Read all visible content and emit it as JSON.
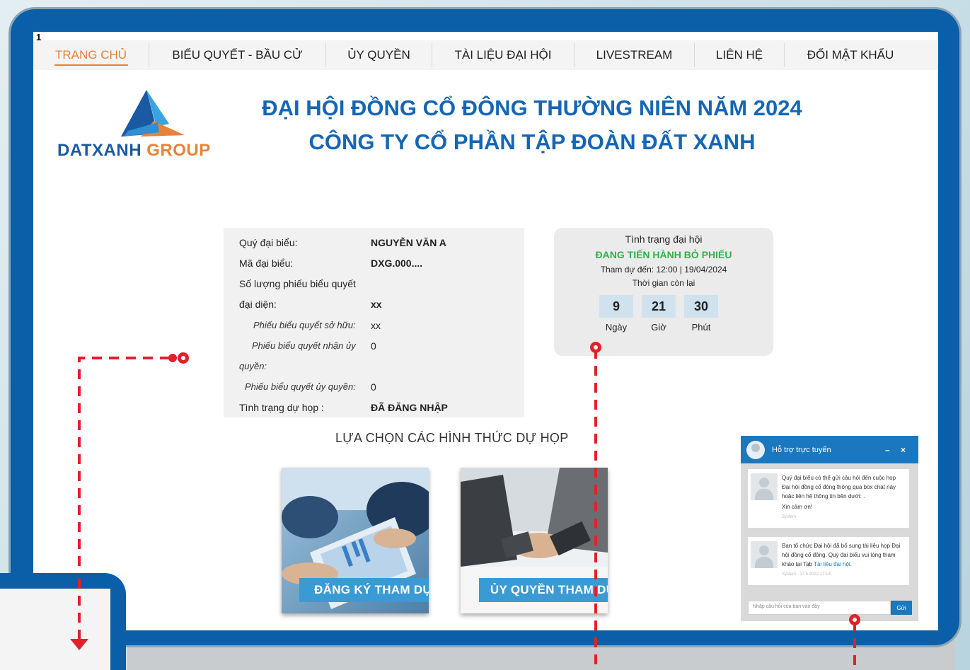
{
  "screen_number": "1",
  "nav": [
    {
      "label": "TRANG CHỦ",
      "active": true
    },
    {
      "label": "BIỂU QUYẾT - BẦU CỬ"
    },
    {
      "label": "ỦY QUYỀN"
    },
    {
      "label": "TÀI LIỆU ĐẠI HỘI"
    },
    {
      "label": "LIVESTREAM"
    },
    {
      "label": "LIÊN HỆ"
    },
    {
      "label": "ĐỔI MẬT KHẨU"
    }
  ],
  "logo": {
    "part1": "DATXANH",
    "part2": " GROUP",
    "colors": {
      "blue": "#1a5aa3",
      "orange": "#e8823a",
      "light_blue": "#3aa4e0"
    }
  },
  "title": {
    "line1": "ĐẠI HỘI ĐỒNG CỔ ĐÔNG THƯỜNG NIÊN NĂM 2024",
    "line2": "CÔNG TY CỔ PHẦN TẬP ĐOÀN ĐẤT XANH"
  },
  "info": {
    "delegate_label": "Quý đại biểu:",
    "delegate_value": "NGUYỄN VĂN A",
    "code_label": "Mã đại biểu:",
    "code_value": "DXG.000....",
    "votes_label_1": "Số lượng phiếu biểu quyết",
    "votes_label_2": "đại diện:",
    "votes_value": "xx",
    "owned_label": "Phiếu biểu quyết sở hữu:",
    "owned_value": "xx",
    "received_label_1": "Phiếu biểu quyết nhận ủy",
    "received_label_2": "quyền:",
    "received_value": "0",
    "delegated_label": "Phiếu biểu quyết ủy quyền:",
    "delegated_value": "0",
    "attend_label": "Tình trạng dự họp :",
    "attend_value": "ĐÃ ĐĂNG NHẬP"
  },
  "status": {
    "title": "Tình trạng đại hội",
    "state": "ĐANG TIẾN HÀNH BỎ PHIẾU",
    "attend_time": "Tham dự đến: 12:00 | 19/04/2024",
    "remaining_label": "Thời gian còn lại",
    "days": "9",
    "hours": "21",
    "minutes": "30",
    "days_label": "Ngày",
    "hours_label": "Giờ",
    "minutes_label": "Phút",
    "state_color": "#2db34a"
  },
  "choose_title": "LỰA CHỌN CÁC HÌNH THỨC DỰ HỌP",
  "cards": {
    "register": "ĐĂNG KÝ THAM DỰ",
    "proxy": "ỦY QUYỀN THAM DỰ"
  },
  "chat": {
    "title": "Hỗ trợ trực tuyến",
    "controls": "– ×",
    "msg1": "Quý đại biểu có thể gửi câu hỏi đến cuộc họp Đại hội đồng cổ đông thông qua box chat này hoặc liên hệ thông tin bên dưới: .",
    "msg1_thanks": "Xin cảm ơn!",
    "msg1_meta": "System",
    "msg2_text": "Ban tổ chức Đại hội đã bổ sung tài liệu họp Đại hội đồng cổ đông. Quý đại biểu vui lòng tham khảo tại Tab",
    "msg2_link": "Tài liệu đại hội",
    "msg2_end": ".",
    "msg2_meta": "System - 17 5 2022 17:18",
    "placeholder": "Nhập câu hỏi của bạn vào đây",
    "send": "Gửi"
  },
  "colors": {
    "frame": "#0a5fa8",
    "accent": "#e8823a",
    "title": "#1566b5",
    "annotation": "#e3202a"
  }
}
